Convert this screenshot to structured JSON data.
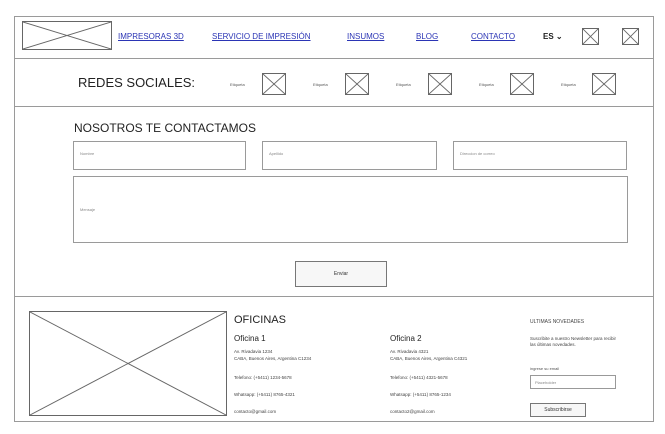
{
  "nav": {
    "links": [
      "IMPRESORAS 3D",
      "SERVICIO DE IMPRESIÓN",
      "INSUMOS",
      "BLOG",
      "CONTACTO"
    ],
    "language": "ES ⌄"
  },
  "social": {
    "title": "REDES SOCIALES:",
    "labels": [
      "Etiqueta",
      "Etiqueta",
      "Etiqueta",
      "Etiqueta",
      "Etiqueta"
    ]
  },
  "contact": {
    "title": "NOSOTROS TE CONTACTAMOS",
    "name_placeholder": "Nombre",
    "surname_placeholder": "Apellido",
    "email_placeholder": "Direccion de correo",
    "message_placeholder": "Mensaje",
    "submit_label": "Enviar"
  },
  "offices": {
    "title": "OFICINAS",
    "items": [
      {
        "name": "Oficina 1",
        "address1": "Av. Rivadavia 1234",
        "address2": "CABA, Buenos Aires, Argentina C1234",
        "phone": "Telefono: (+5411) 1234-5678",
        "whatsapp": "Whatsapp: (+5411) 8765-4321",
        "email": "contacto@gmail.com"
      },
      {
        "name": "Oficina 2",
        "address1": "Av. Rivadavia 4321",
        "address2": "CABA, Buenos Aires, Argentina C4321",
        "phone": "Telefono: (+5411) 4321-5678",
        "whatsapp": "Whatsapp: (+5411) 8765-1234",
        "email": "contacto2@gmail.com"
      }
    ]
  },
  "newsletter": {
    "title": "ULTIMAS NOVEDADES",
    "text": "Suscribite a nuestro Newsletter para recibir las últimas novedades.",
    "email_label": "ingrese su email",
    "email_placeholder": "Placeholder",
    "subscribe_label": "Subscribirse"
  }
}
